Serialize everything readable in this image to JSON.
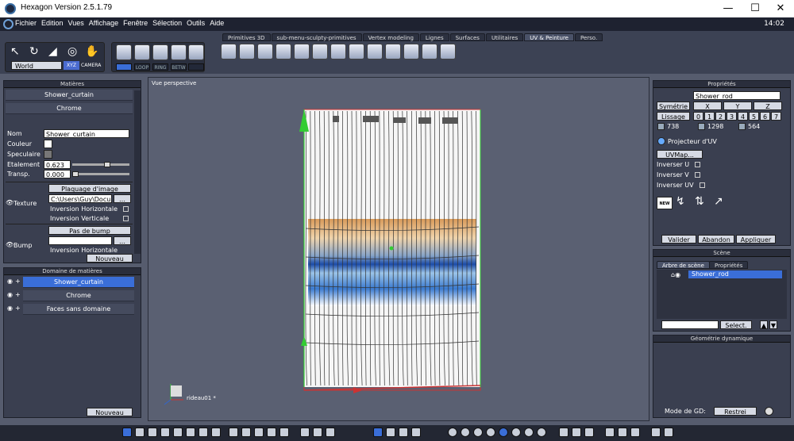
{
  "window": {
    "title": "Hexagon Version 2.5.1.79",
    "minimize": "—",
    "maximize": "☐",
    "close": "✕"
  },
  "menu": {
    "items": [
      "Fichier",
      "Edition",
      "Vues",
      "Affichage",
      "Fenêtre",
      "Sélection",
      "Outils",
      "Aide"
    ],
    "clock": "14:02"
  },
  "toolbar": {
    "world": "World",
    "xyz": "XYZ",
    "camera": "CAMERA",
    "loop": "LOOP",
    "ring": "RING",
    "betw": "BETW",
    "tabs": [
      "Primitives 3D",
      "sub-menu-sculpty-primitives",
      "Vertex modeling",
      "Lignes",
      "Surfaces",
      "Utilitaires",
      "UV & Peinture",
      "Perso."
    ],
    "active_tab": "UV & Peinture"
  },
  "materials": {
    "title": "Matières",
    "list": [
      "Shower_curtain",
      "Chrome"
    ],
    "nom_label": "Nom",
    "nom_value": "Shower_curtain",
    "couleur_label": "Couleur",
    "speculaire_label": "Speculaire",
    "etalement_label": "Etalement",
    "etalement_value": "0.623",
    "etalement_level": 0.62,
    "transp_label": "Transp.",
    "transp_value": "0.000",
    "transp_level": 0.0,
    "texture_label": "Texture",
    "texture_type": "Plaquage d'image",
    "texture_path": "C:\\Users\\Guy\\Docu",
    "inv_h": "Inversion Horizontale",
    "inv_v": "Inversion Verticale",
    "bump_label": "Bump",
    "bump_type": "Pas de bump",
    "bump_inv_h": "Inversion Horizontale",
    "new_button": "Nouveau"
  },
  "domain": {
    "title": "Domaine de matières",
    "items": [
      "Shower_curtain",
      "Chrome",
      "Faces sans domaine"
    ],
    "new_button": "Nouveau"
  },
  "viewport": {
    "title": "Vue perspective",
    "object_label": "rideau01 *"
  },
  "properties": {
    "title": "Propriétés",
    "name_value": "Shower_rod",
    "symmetry": "Symétrie",
    "x": "X",
    "y": "Y",
    "z": "Z",
    "lissage": "Lissage",
    "levels": [
      "0",
      "1",
      "2",
      "3",
      "4",
      "5",
      "6",
      "7"
    ],
    "counts": [
      "738",
      "1298",
      "564"
    ],
    "uv_projector": "Projecteur d'UV",
    "uvmap": "UVMap...",
    "inverser_u": "Inverser U",
    "inverser_v": "Inverser V",
    "inverser_uv": "Inverser UV",
    "new_icon": "NEW",
    "valider": "Valider",
    "abandon": "Abandon",
    "appliquer": "Appliquer"
  },
  "scene": {
    "title": "Scène",
    "tab_tree": "Arbre de scène",
    "tab_props": "Propriétés",
    "item": "Shower_rod",
    "select_button": "Select."
  },
  "dyngeo": {
    "title": "Géométrie dynamique",
    "mode_label": "Mode de GD:",
    "mode_value": "Restrei"
  }
}
